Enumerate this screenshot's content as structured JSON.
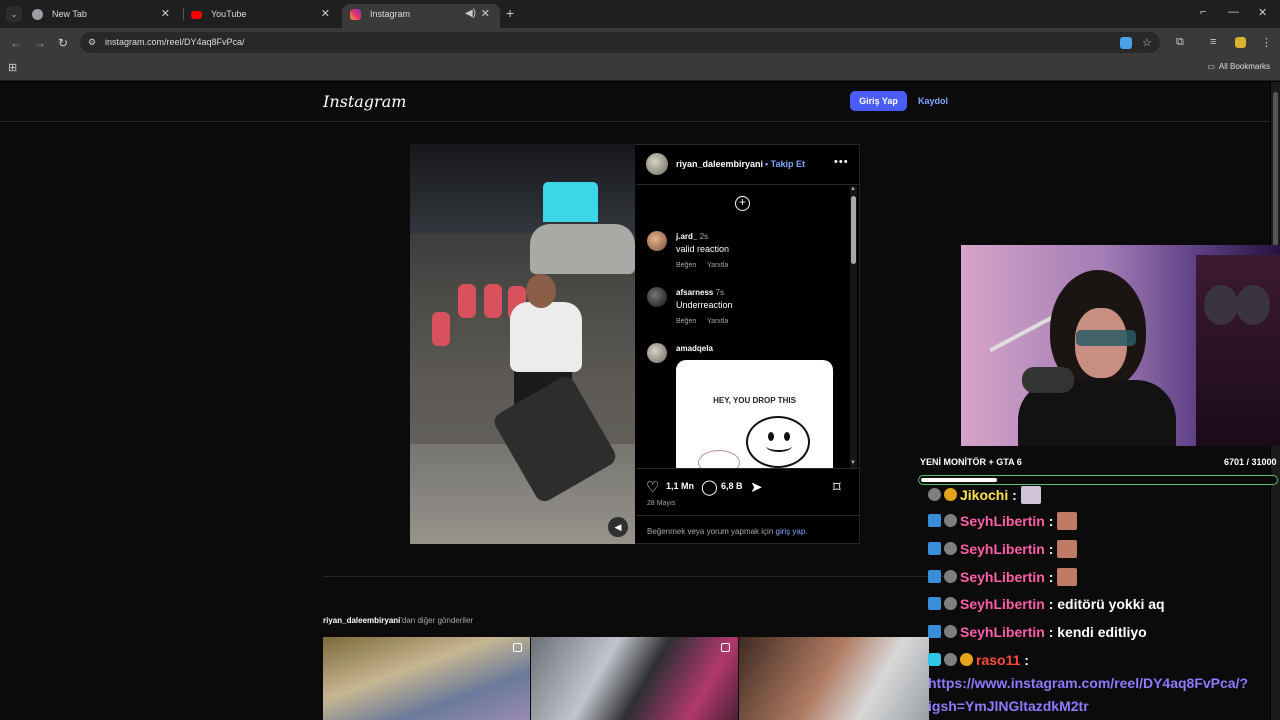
{
  "browser": {
    "tabs": [
      {
        "label": "New Tab"
      },
      {
        "label": "YouTube"
      },
      {
        "label": "Instagram"
      }
    ],
    "url": "instagram.com/reel/DY4aq8FvPca/",
    "bookmarks_label": "All Bookmarks"
  },
  "instagram": {
    "logo": "Instagram",
    "login_label": "Giriş Yap",
    "signup_label": "Kaydol",
    "post": {
      "author": "riyan_daleembiryani",
      "follow_label": "• Takip Et",
      "comments": [
        {
          "user": "j.ard_",
          "time": "2s",
          "text": "valid reaction",
          "like": "Beğen",
          "reply": "Yanıtla"
        },
        {
          "user": "afsarness",
          "time": "7s",
          "text": "Underreaction",
          "like": "Beğen",
          "reply": "Yanıtla"
        },
        {
          "user": "amadqela",
          "time": "",
          "text": "",
          "like": "",
          "reply": ""
        }
      ],
      "meme_text": "HEY, YOU DROP THIS",
      "likes": "1,1 Mn",
      "comments_count": "6,8 B",
      "date": "28 Mayıs",
      "login_prompt": "Beğenmek veya yorum yapmak için ",
      "login_link": "giriş yap",
      "login_suffix": "."
    },
    "more_posts_user": "riyan_daleembiryani",
    "more_posts_suffix": "'dan diğer gönderiler"
  },
  "stream": {
    "goal_label": "YENİ MONİTÖR + GTA 6",
    "goal_count": "6701 / 31000",
    "goal_progress": 0.216,
    "chat": [
      {
        "user": "Jikochi",
        "text": ""
      },
      {
        "user": "SeyhLibertin",
        "text": ""
      },
      {
        "user": "SeyhLibertin",
        "text": ""
      },
      {
        "user": "SeyhLibertin",
        "text": ""
      },
      {
        "user": "SeyhLibertin",
        "text": "editörü yokki aq"
      },
      {
        "user": "SeyhLibertin",
        "text": "kendi editliyo"
      },
      {
        "user": "raso11",
        "text": ""
      }
    ],
    "colon": ":",
    "link_line1": "https://www.instagram.com/reel/DY4aq8FvPca/?",
    "link_line2": "igsh=YmJlNGltazdkM2tr"
  }
}
